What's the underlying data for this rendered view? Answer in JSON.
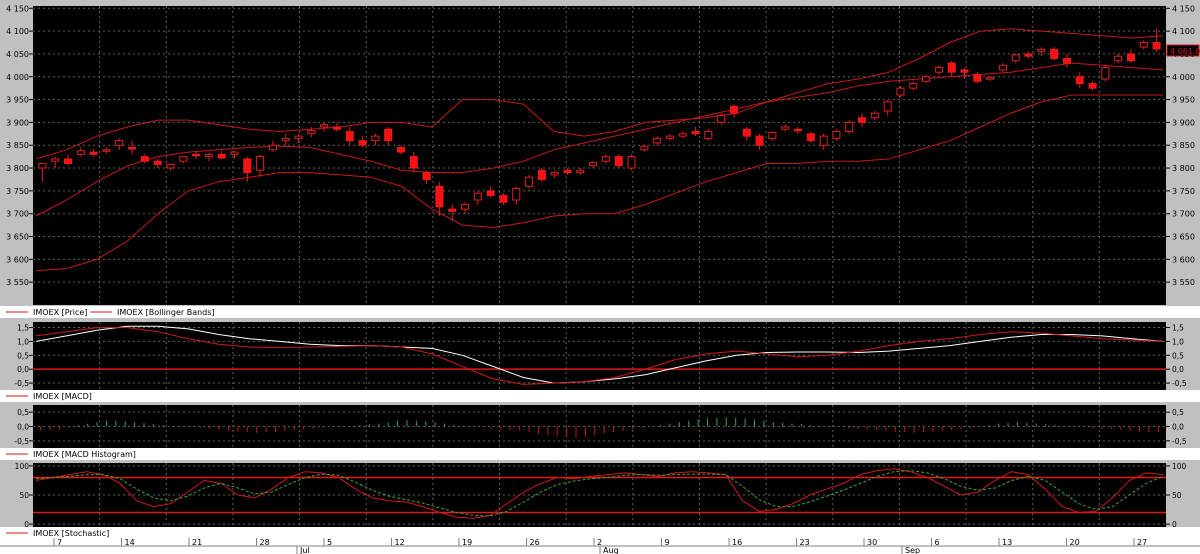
{
  "chart_data": [
    {
      "type": "candlestick",
      "name": "price-panel",
      "legend": [
        {
          "label": "IMOEX [Price]",
          "color": "#d01818"
        },
        {
          "label": "IMOEX [Bollinger Bands]",
          "color": "#d01818"
        }
      ],
      "ylim": [
        3500,
        4155
      ],
      "yticks": [
        3550,
        3600,
        3650,
        3700,
        3750,
        3800,
        3850,
        3900,
        3950,
        4000,
        4050,
        4100,
        4150
      ],
      "ytick_labels": [
        "3 550",
        "3 600",
        "3 650",
        "3 700",
        "3 750",
        "3 800",
        "3 850",
        "3 900",
        "3 950",
        "4 000",
        "4 050",
        "4 100",
        "4 150"
      ],
      "last_price_label": "4 061,02",
      "candles": [
        [
          3800,
          3810,
          3770,
          3810
        ],
        [
          3815,
          3825,
          3800,
          3820
        ],
        [
          3820,
          3830,
          3805,
          3810
        ],
        [
          3830,
          3845,
          3825,
          3838
        ],
        [
          3835,
          3842,
          3825,
          3830
        ],
        [
          3838,
          3845,
          3832,
          3840
        ],
        [
          3850,
          3865,
          3840,
          3860
        ],
        [
          3845,
          3860,
          3830,
          3842
        ],
        [
          3825,
          3830,
          3810,
          3815
        ],
        [
          3815,
          3820,
          3800,
          3808
        ],
        [
          3800,
          3810,
          3795,
          3808
        ],
        [
          3815,
          3825,
          3810,
          3825
        ],
        [
          3830,
          3835,
          3820,
          3828
        ],
        [
          3825,
          3833,
          3815,
          3830
        ],
        [
          3830,
          3838,
          3820,
          3822
        ],
        [
          3830,
          3838,
          3820,
          3835
        ],
        [
          3820,
          3825,
          3770,
          3790
        ],
        [
          3795,
          3830,
          3780,
          3825
        ],
        [
          3840,
          3860,
          3835,
          3850
        ],
        [
          3860,
          3875,
          3850,
          3865
        ],
        [
          3865,
          3875,
          3855,
          3870
        ],
        [
          3875,
          3890,
          3868,
          3882
        ],
        [
          3890,
          3900,
          3880,
          3895
        ],
        [
          3890,
          3900,
          3880,
          3885
        ],
        [
          3880,
          3890,
          3850,
          3860
        ],
        [
          3860,
          3870,
          3845,
          3850
        ],
        [
          3860,
          3875,
          3850,
          3870
        ],
        [
          3885,
          3890,
          3850,
          3860
        ],
        [
          3845,
          3850,
          3830,
          3835
        ],
        [
          3825,
          3835,
          3790,
          3800
        ],
        [
          3790,
          3795,
          3765,
          3775
        ],
        [
          3760,
          3770,
          3695,
          3715
        ],
        [
          3710,
          3720,
          3685,
          3705
        ],
        [
          3710,
          3725,
          3700,
          3720
        ],
        [
          3730,
          3750,
          3720,
          3745
        ],
        [
          3750,
          3760,
          3735,
          3740
        ],
        [
          3740,
          3745,
          3720,
          3725
        ],
        [
          3730,
          3760,
          3720,
          3755
        ],
        [
          3760,
          3785,
          3755,
          3780
        ],
        [
          3795,
          3800,
          3770,
          3775
        ],
        [
          3785,
          3795,
          3778,
          3790
        ],
        [
          3795,
          3800,
          3785,
          3790
        ],
        [
          3790,
          3800,
          3785,
          3795
        ],
        [
          3805,
          3815,
          3800,
          3812
        ],
        [
          3815,
          3830,
          3810,
          3825
        ],
        [
          3825,
          3830,
          3800,
          3805
        ],
        [
          3800,
          3830,
          3795,
          3825
        ],
        [
          3840,
          3850,
          3835,
          3848
        ],
        [
          3855,
          3870,
          3850,
          3865
        ],
        [
          3865,
          3875,
          3860,
          3870
        ],
        [
          3870,
          3880,
          3865,
          3875
        ],
        [
          3880,
          3890,
          3870,
          3875
        ],
        [
          3865,
          3885,
          3860,
          3880
        ],
        [
          3900,
          3920,
          3895,
          3915
        ],
        [
          3935,
          3940,
          3910,
          3920
        ],
        [
          3885,
          3890,
          3860,
          3870
        ],
        [
          3870,
          3875,
          3840,
          3850
        ],
        [
          3865,
          3880,
          3860,
          3878
        ],
        [
          3885,
          3895,
          3880,
          3890
        ],
        [
          3885,
          3890,
          3875,
          3882
        ],
        [
          3875,
          3880,
          3855,
          3860
        ],
        [
          3850,
          3875,
          3840,
          3870
        ],
        [
          3865,
          3885,
          3860,
          3880
        ],
        [
          3880,
          3905,
          3875,
          3900
        ],
        [
          3910,
          3920,
          3890,
          3900
        ],
        [
          3910,
          3925,
          3905,
          3920
        ],
        [
          3925,
          3950,
          3915,
          3945
        ],
        [
          3960,
          3980,
          3955,
          3975
        ],
        [
          3975,
          3990,
          3970,
          3985
        ],
        [
          3990,
          4005,
          3985,
          4000
        ],
        [
          4010,
          4025,
          4005,
          4020
        ],
        [
          4030,
          4035,
          4000,
          4010
        ],
        [
          4015,
          4020,
          3995,
          4010
        ],
        [
          4005,
          4010,
          3985,
          3990
        ],
        [
          3995,
          4000,
          3990,
          3998
        ],
        [
          4015,
          4030,
          4010,
          4025
        ],
        [
          4035,
          4050,
          4030,
          4048
        ],
        [
          4050,
          4055,
          4040,
          4045
        ],
        [
          4055,
          4065,
          4045,
          4060
        ],
        [
          4060,
          4065,
          4035,
          4040
        ],
        [
          4040,
          4050,
          4020,
          4030
        ],
        [
          4000,
          4010,
          3975,
          3985
        ],
        [
          3985,
          3990,
          3970,
          3975
        ],
        [
          3995,
          4025,
          3990,
          4020
        ],
        [
          4035,
          4050,
          4030,
          4045
        ],
        [
          4050,
          4060,
          4030,
          4035
        ],
        [
          4065,
          4080,
          4060,
          4075
        ],
        [
          4075,
          4105,
          4055,
          4061
        ]
      ],
      "bands": {
        "upper": [
          3820,
          3840,
          3870,
          3890,
          3905,
          3905,
          3895,
          3885,
          3880,
          3885,
          3890,
          3900,
          3900,
          3890,
          3950,
          3950,
          3940,
          3880,
          3870,
          3880,
          3900,
          3905,
          3910,
          3920,
          3945,
          3965,
          3985,
          3995,
          4010,
          4040,
          4075,
          4100,
          4105,
          4100,
          4095,
          4090,
          4085,
          4090
        ],
        "middle": [
          3695,
          3730,
          3770,
          3805,
          3825,
          3835,
          3840,
          3845,
          3848,
          3845,
          3830,
          3815,
          3795,
          3790,
          3790,
          3800,
          3815,
          3840,
          3855,
          3870,
          3885,
          3900,
          3915,
          3930,
          3945,
          3955,
          3965,
          3980,
          3990,
          3995,
          4000,
          4005,
          4010,
          4020,
          4030,
          4025,
          4020,
          4015
        ],
        "lower": [
          3575,
          3580,
          3600,
          3640,
          3700,
          3750,
          3770,
          3780,
          3790,
          3790,
          3785,
          3780,
          3760,
          3710,
          3675,
          3670,
          3680,
          3695,
          3700,
          3700,
          3720,
          3745,
          3770,
          3790,
          3810,
          3810,
          3815,
          3815,
          3820,
          3840,
          3860,
          3890,
          3920,
          3945,
          3960,
          3960,
          3960,
          3960
        ]
      }
    },
    {
      "type": "line",
      "name": "macd-panel",
      "legend": [
        {
          "label": "IMOEX [MACD]",
          "color": "#d01818"
        }
      ],
      "ylim": [
        -0.75,
        1.7
      ],
      "yticks": [
        1.5,
        1.0,
        0.5,
        0.0,
        -0.5
      ],
      "ytick_labels": [
        "1,5",
        "1,0",
        "0,5",
        "0,0",
        "-0,5"
      ],
      "zero_line": 0.0,
      "series": [
        {
          "color": "#ffffff",
          "values": [
            1.0,
            1.2,
            1.4,
            1.55,
            1.55,
            1.45,
            1.25,
            1.1,
            1.0,
            0.9,
            0.85,
            0.85,
            0.8,
            0.75,
            0.5,
            0.1,
            -0.3,
            -0.5,
            -0.45,
            -0.35,
            -0.2,
            0.05,
            0.3,
            0.5,
            0.6,
            0.62,
            0.62,
            0.6,
            0.65,
            0.75,
            0.85,
            1.0,
            1.15,
            1.25,
            1.25,
            1.2,
            1.1,
            1.0
          ]
        },
        {
          "color": "#d01818",
          "values": [
            1.2,
            1.35,
            1.5,
            1.5,
            1.35,
            1.1,
            0.9,
            0.8,
            0.78,
            0.8,
            0.82,
            0.85,
            0.8,
            0.55,
            0.1,
            -0.35,
            -0.55,
            -0.5,
            -0.45,
            -0.3,
            0.0,
            0.35,
            0.55,
            0.65,
            0.55,
            0.45,
            0.5,
            0.65,
            0.85,
            1.0,
            1.1,
            1.25,
            1.35,
            1.3,
            1.2,
            1.1,
            1.05,
            1.0
          ]
        }
      ]
    },
    {
      "type": "bar",
      "name": "macd-histogram-panel",
      "legend": [
        {
          "label": "IMOEX [MACD Histogram]",
          "color": "#d01818"
        }
      ],
      "ylim": [
        -0.75,
        0.75
      ],
      "yticks": [
        0.5,
        0.0,
        -0.5
      ],
      "ytick_labels": [
        "0,5",
        "0,0",
        "-0,5"
      ],
      "values": [
        -0.15,
        -0.12,
        -0.1,
        -0.05,
        0.05,
        0.1,
        0.15,
        0.2,
        0.2,
        0.18,
        0.15,
        0.12,
        0.08,
        0.05,
        0.02,
        0.0,
        -0.02,
        -0.05,
        -0.08,
        -0.12,
        -0.15,
        -0.18,
        -0.2,
        -0.22,
        -0.2,
        -0.18,
        -0.15,
        -0.12,
        -0.1,
        -0.08,
        -0.05,
        -0.03,
        0.0,
        0.02,
        0.05,
        0.08,
        0.1,
        0.15,
        0.2,
        0.22,
        0.2,
        0.18,
        0.15,
        0.1,
        0.05,
        0.02,
        0.0,
        -0.02,
        -0.05,
        -0.08,
        -0.12,
        -0.15,
        -0.2,
        -0.25,
        -0.3,
        -0.32,
        -0.35,
        -0.38,
        -0.35,
        -0.3,
        -0.25,
        -0.2,
        -0.15,
        -0.1,
        -0.05,
        0.0,
        0.05,
        0.1,
        0.15,
        0.2,
        0.25,
        0.28,
        0.3,
        0.32,
        0.3,
        0.28,
        0.25,
        0.2,
        0.15,
        0.12,
        0.1,
        0.08,
        0.05,
        0.02,
        0.0,
        -0.02,
        -0.05,
        -0.08,
        -0.1,
        -0.12,
        -0.15,
        -0.18,
        -0.2,
        -0.22,
        -0.2,
        -0.18,
        -0.15,
        -0.12,
        -0.08,
        -0.05,
        0.0,
        0.05,
        0.1,
        0.12,
        0.15,
        0.12,
        0.1,
        0.08,
        0.05,
        0.02,
        0.0,
        -0.02,
        -0.05,
        -0.08,
        -0.1,
        -0.12,
        -0.15,
        -0.18,
        -0.2,
        -0.2
      ]
    },
    {
      "type": "line",
      "name": "stochastic-panel",
      "legend": [
        {
          "label": "IMOEX [Stochastic]",
          "color": "#d01818"
        }
      ],
      "ylim": [
        -5,
        105
      ],
      "yticks": [
        100,
        50,
        0
      ],
      "ytick_labels": [
        "100",
        "50",
        "0"
      ],
      "levels": [
        80,
        20
      ],
      "series": [
        {
          "color": "#d01818",
          "values": [
            75,
            80,
            85,
            90,
            85,
            70,
            40,
            30,
            35,
            55,
            75,
            70,
            50,
            45,
            60,
            80,
            90,
            88,
            80,
            60,
            45,
            40,
            38,
            30,
            20,
            12,
            10,
            15,
            35,
            55,
            70,
            80,
            78,
            82,
            85,
            88,
            85,
            82,
            88,
            90,
            88,
            85,
            40,
            22,
            25,
            35,
            50,
            60,
            70,
            85,
            92,
            95,
            90,
            80,
            65,
            50,
            55,
            75,
            90,
            85,
            60,
            30,
            20,
            22,
            45,
            75,
            88,
            85
          ]
        },
        {
          "color": "#3aa83a",
          "dashed": true,
          "values": [
            78,
            80,
            82,
            85,
            85,
            78,
            60,
            45,
            40,
            48,
            62,
            70,
            62,
            52,
            55,
            68,
            80,
            86,
            84,
            72,
            58,
            48,
            42,
            36,
            28,
            20,
            15,
            14,
            22,
            38,
            55,
            68,
            74,
            78,
            80,
            84,
            85,
            84,
            85,
            86,
            86,
            85,
            65,
            42,
            30,
            30,
            38,
            48,
            58,
            70,
            82,
            90,
            92,
            88,
            78,
            65,
            58,
            62,
            75,
            82,
            75,
            55,
            35,
            25,
            30,
            50,
            70,
            82
          ]
        }
      ]
    }
  ],
  "time_axis": {
    "day_labels": [
      "7",
      "14",
      "21",
      "28",
      "5",
      "12",
      "19",
      "26",
      "2",
      "9",
      "16",
      "23",
      "30",
      "6",
      "13",
      "20",
      "27"
    ],
    "month_labels": [
      "Jul",
      "Aug",
      "Sep"
    ]
  }
}
